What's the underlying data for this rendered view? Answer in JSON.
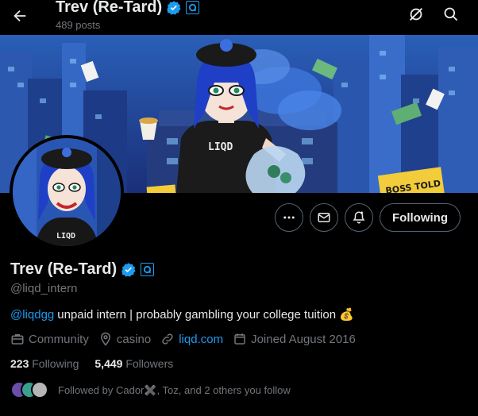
{
  "header": {
    "title": "Trev (Re-Tard)",
    "posts": "489 posts"
  },
  "profile": {
    "display_name": "Trev (Re-Tard)",
    "handle": "@liqd_intern",
    "bio_mention": "@liqdgg",
    "bio_text": "unpaid intern | probably gambling your college tuition",
    "bio_emoji": "💰",
    "category": "Community",
    "location": "casino",
    "website": "liqd.com",
    "joined": "Joined August 2016",
    "following_count": "223",
    "following_label": "Following",
    "followers_count": "5,449",
    "followers_label": "Followers",
    "followed_by": "Followed by Cador✖️, Toz, and 2 others you follow"
  },
  "actions": {
    "follow_label": "Following"
  },
  "banner": {
    "sign_text": "BOSS TOLD"
  },
  "avatar": {
    "shirt_text": "LIQD"
  },
  "colors": {
    "accent": "#1d9bf0",
    "muted": "#71767b",
    "text": "#e7e9ea",
    "border": "#536471"
  }
}
